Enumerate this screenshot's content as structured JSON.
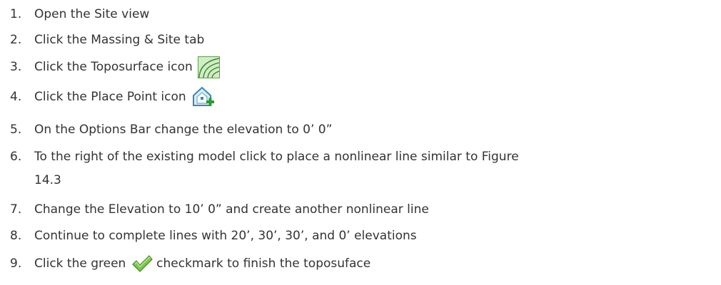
{
  "steps": [
    {
      "num": "1.",
      "text": "Open the Site view"
    },
    {
      "num": "2.",
      "text": "Click the Massing & Site tab"
    },
    {
      "num": "3.",
      "text": "Click the Toposurface icon",
      "icon": "toposurface-icon"
    },
    {
      "num": "4.",
      "text": "Click the Place Point icon",
      "icon": "place-point-icon"
    },
    {
      "num": "5.",
      "text": "On the Options Bar change the elevation to 0’ 0”"
    },
    {
      "num": "6.",
      "text": "To the right of the existing model click to place a nonlinear line similar to Figure",
      "cont": "14.3"
    },
    {
      "num": "7.",
      "text": "Change the Elevation to 10’ 0” and create another nonlinear line"
    },
    {
      "num": "8.",
      "text": "Continue to complete lines with 20’, 30’, 30’, and 0’ elevations"
    },
    {
      "num": "9.",
      "text_before": "Click the green",
      "icon": "checkmark-icon",
      "text_after": "checkmark to finish the toposuface"
    }
  ]
}
